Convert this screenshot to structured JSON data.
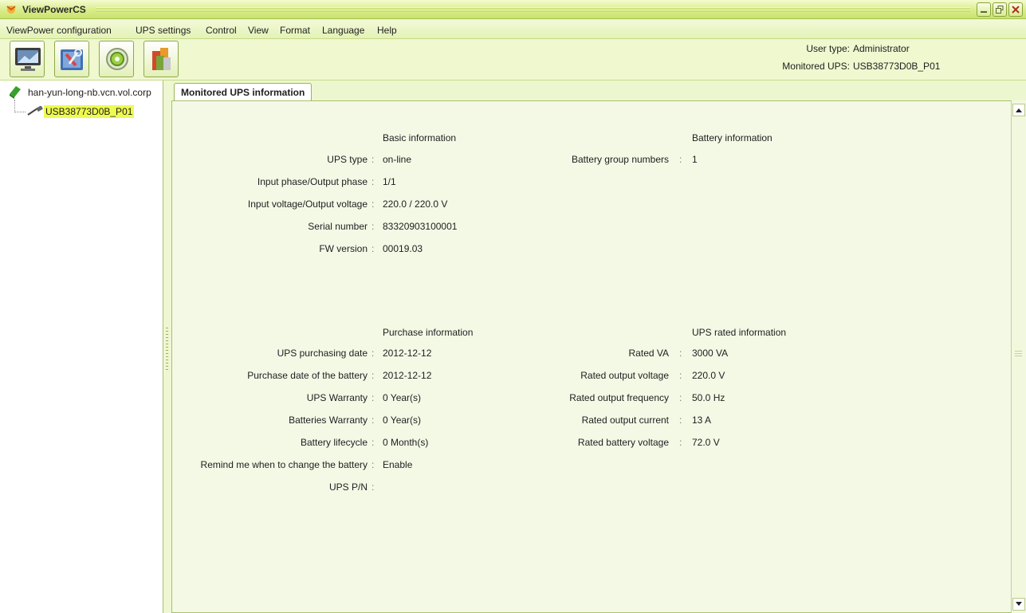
{
  "window": {
    "title": "ViewPowerCS"
  },
  "menu": [
    "ViewPower configuration",
    "UPS settings",
    "Control",
    "View",
    "Format",
    "Language",
    "Help"
  ],
  "toolbar": {
    "buttons": [
      {
        "icon": "monitor-icon"
      },
      {
        "icon": "tools-icon"
      },
      {
        "icon": "settings-gear-icon"
      },
      {
        "icon": "battery-chart-icon"
      }
    ],
    "user_type_label": "User type:",
    "user_type_value": "Administrator",
    "monitored_ups_label": "Monitored UPS:",
    "monitored_ups_value": "USB38773D0B_P01"
  },
  "tree": {
    "root": "han-yun-long-nb.vcn.vol.corp",
    "child": "USB38773D0B_P01"
  },
  "tab": {
    "label": "Monitored UPS information"
  },
  "basic": {
    "title": "Basic information",
    "rows": [
      {
        "label": "UPS type",
        "value": "on-line"
      },
      {
        "label": "Input phase/Output phase",
        "value": "1/1"
      },
      {
        "label": "Input voltage/Output voltage",
        "value": "220.0  /  220.0  V"
      },
      {
        "label": "Serial number",
        "value": "83320903100001"
      },
      {
        "label": "FW version",
        "value": "00019.03"
      }
    ]
  },
  "battery": {
    "title": "Battery information",
    "rows": [
      {
        "label": "Battery group numbers",
        "value": "1"
      }
    ]
  },
  "purchase": {
    "title": "Purchase information",
    "rows": [
      {
        "label": "UPS purchasing date",
        "value": "2012-12-12"
      },
      {
        "label": "Purchase date of the battery",
        "value": "2012-12-12"
      },
      {
        "label": "UPS Warranty",
        "value": "0  Year(s)"
      },
      {
        "label": "Batteries Warranty",
        "value": "0  Year(s)"
      },
      {
        "label": "Battery lifecycle",
        "value": "0  Month(s)"
      },
      {
        "label": "Remind me when to change the battery",
        "value": "Enable"
      },
      {
        "label": "UPS P/N",
        "value": ""
      }
    ]
  },
  "rated": {
    "title": "UPS rated information",
    "rows": [
      {
        "label": "Rated VA",
        "value": "3000  VA"
      },
      {
        "label": "Rated output voltage",
        "value": "220.0  V"
      },
      {
        "label": "Rated output frequency",
        "value": "50.0  Hz"
      },
      {
        "label": "Rated output current",
        "value": "13  A"
      },
      {
        "label": "Rated battery voltage",
        "value": "72.0  V"
      }
    ]
  },
  "colon": ":"
}
